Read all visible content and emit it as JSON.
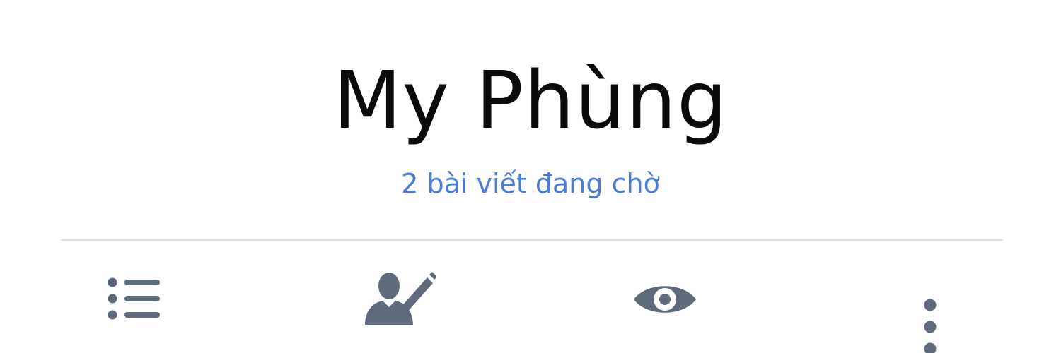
{
  "profile": {
    "name": "My Phùng",
    "pending_posts": "2 bài viết đang chờ"
  },
  "toolbar": {
    "items": [
      {
        "id": "activity-log",
        "icon": "list-icon"
      },
      {
        "id": "update-info",
        "icon": "edit-profile-icon"
      },
      {
        "id": "view-as",
        "icon": "eye-icon"
      },
      {
        "id": "more",
        "icon": "more-vertical-icon"
      }
    ]
  },
  "colors": {
    "name_text": "#0b0b0b",
    "pending_link": "#4a7dd8",
    "icon_gray": "#5f6a7a",
    "divider": "#e2e4e8",
    "background": "#ffffff"
  }
}
